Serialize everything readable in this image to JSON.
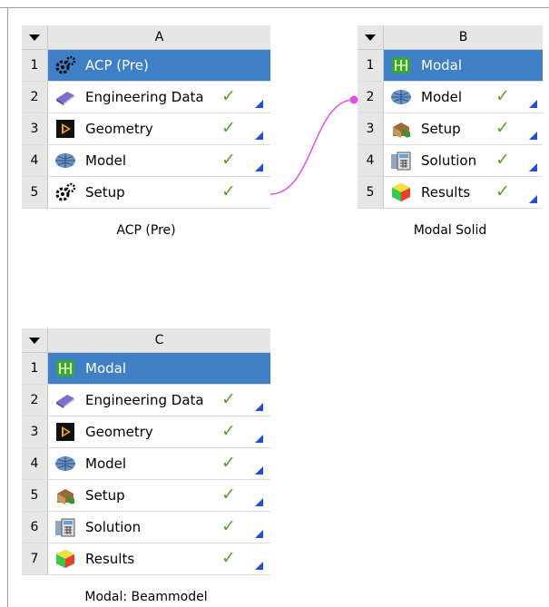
{
  "systems": [
    {
      "letter": "A",
      "caption": "ACP (Pre)",
      "rows": [
        {
          "num": "1",
          "label": "ACP (Pre)",
          "icon": "gears-icon"
        },
        {
          "num": "2",
          "label": "Engineering Data",
          "icon": "book-icon",
          "status": "✓"
        },
        {
          "num": "3",
          "label": "Geometry",
          "icon": "geometry-icon",
          "status": "✓"
        },
        {
          "num": "4",
          "label": "Model",
          "icon": "mesh-icon",
          "status": "✓"
        },
        {
          "num": "5",
          "label": "Setup",
          "icon": "gears-icon",
          "status": "✓"
        }
      ]
    },
    {
      "letter": "B",
      "caption": "Modal Solid",
      "rows": [
        {
          "num": "1",
          "label": "Modal",
          "icon": "modal-icon"
        },
        {
          "num": "2",
          "label": "Model",
          "icon": "mesh-icon",
          "status": "✓"
        },
        {
          "num": "3",
          "label": "Setup",
          "icon": "setup-icon",
          "status": "✓"
        },
        {
          "num": "4",
          "label": "Solution",
          "icon": "solution-icon",
          "status": "✓"
        },
        {
          "num": "5",
          "label": "Results",
          "icon": "results-icon",
          "status": "✓"
        }
      ]
    },
    {
      "letter": "C",
      "caption": "Modal: Beammodel",
      "rows": [
        {
          "num": "1",
          "label": "Modal",
          "icon": "modal-icon"
        },
        {
          "num": "2",
          "label": "Engineering Data",
          "icon": "book-icon",
          "status": "✓"
        },
        {
          "num": "3",
          "label": "Geometry",
          "icon": "geometry-icon",
          "status": "✓"
        },
        {
          "num": "4",
          "label": "Model",
          "icon": "mesh-icon",
          "status": "✓"
        },
        {
          "num": "5",
          "label": "Setup",
          "icon": "setup-icon",
          "status": "✓"
        },
        {
          "num": "6",
          "label": "Solution",
          "icon": "solution-icon",
          "status": "✓"
        },
        {
          "num": "7",
          "label": "Results",
          "icon": "results-icon",
          "status": "✓"
        }
      ]
    }
  ],
  "connection": {
    "from": "A5",
    "to": "B2",
    "color": "#e24fe6"
  },
  "colors": {
    "selected": "#3f7fc6",
    "check": "#5f9c2e",
    "triangle": "#1f4fd6",
    "header": "#e6e6e6"
  }
}
